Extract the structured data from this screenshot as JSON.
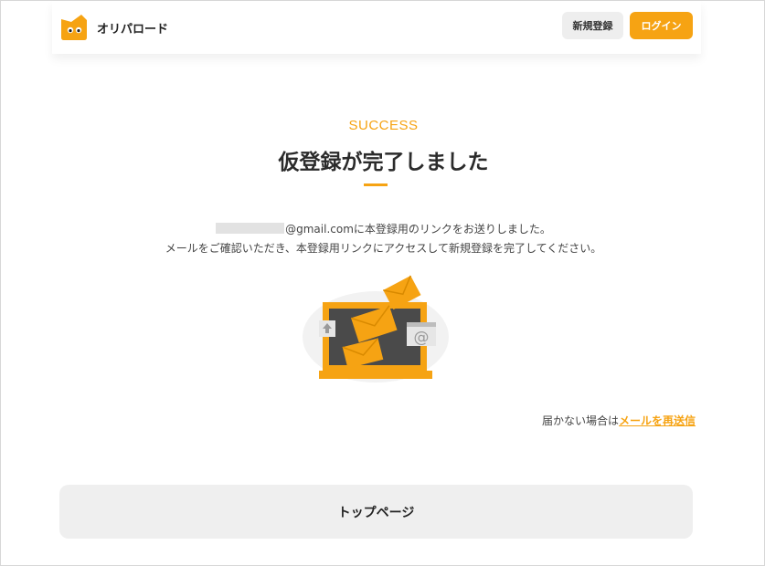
{
  "header": {
    "logo_text": "オリパロード",
    "register_label": "新規登録",
    "login_label": "ログイン"
  },
  "main": {
    "success_label": "SUCCESS",
    "title": "仮登録が完了しました",
    "message_line1_suffix": "@gmail.comに本登録用のリンクをお送りしました。",
    "message_line2": "メールをご確認いただき、本登録用リンクにアクセスして新規登録を完了してください。",
    "resend_prefix": "届かない場合は",
    "resend_link": "メールを再送信",
    "top_page_button": "トップページ"
  },
  "illustration": {
    "at_symbol": "@",
    "upload_icon": "upload-arrow-icon"
  },
  "colors": {
    "accent": "#f6a313",
    "button_bg": "#efefef",
    "text": "#333333"
  }
}
